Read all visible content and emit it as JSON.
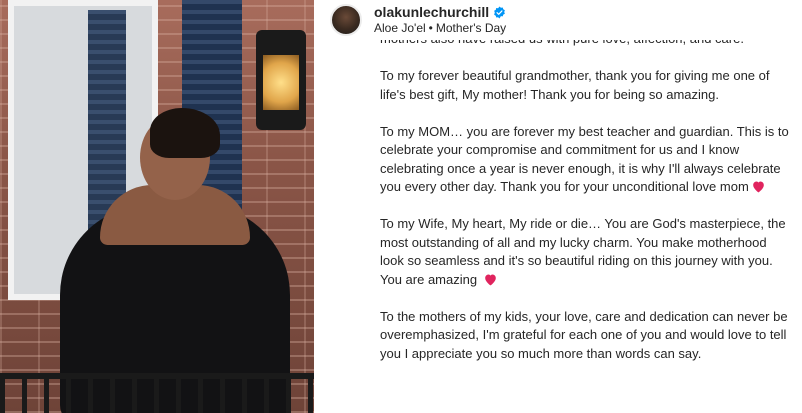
{
  "header": {
    "username": "olakunlechurchill",
    "audio": "Aloe Jo'el",
    "separator": "•",
    "title": "Mother's Day"
  },
  "caption": {
    "paragraphs": [
      "mothers also have raised us with pure love, affection, and care.",
      "To my forever beautiful grandmother, thank you for giving me one of life's best gift, My mother! Thank you for being so amazing.",
      "To my MOM… you are forever my best teacher and guardian. This is to celebrate your compromise and commitment for us and I know celebrating once a year is never enough, it is why I'll always celebrate you every other day. Thank you for your unconditional love mom",
      "To my Wife, My heart, My ride or die… You are God's masterpiece, the most outstanding of all and my lucky charm. You make motherhood look so seamless and it's so beautiful riding on this journey with you. You are amazing",
      "To the mothers of my kids, your love, care and dedication can never be overemphasized, I'm grateful for each one of you and would love to tell you I appreciate you so much more than words can say."
    ]
  },
  "icons": {
    "verified": "verified-badge-icon",
    "heart": "red-heart-emoji"
  },
  "colors": {
    "verified": "#0095f6",
    "heart": "#e0245e",
    "text": "#262626"
  }
}
